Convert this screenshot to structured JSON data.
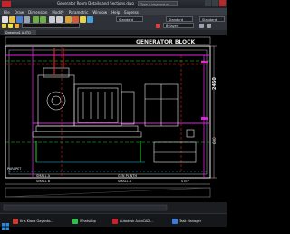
{
  "window": {
    "title": "Generator Room Details and Sections.dwg",
    "search_placeholder": "Type a keyword or phrase"
  },
  "menubar": {
    "items": [
      "File",
      "Draw",
      "Dimension",
      "Modify",
      "Parametric",
      "Window",
      "Help",
      "Express"
    ]
  },
  "ribbon": {
    "style_value": "Standard",
    "dim_style_value": "Standard",
    "right_value": "Standard"
  },
  "layer_panel": {
    "current_layer": "Bylayer"
  },
  "tabs": {
    "active": "Drawing1 AUTO"
  },
  "drawing": {
    "heading": "GENERATOR BLOCK",
    "label_left_a": "PARAPET",
    "label_left_b": "SMALL A",
    "label_left_c": "SMALL B",
    "label_mid_a": "GEN PLINTH",
    "label_mid_b": "SMALL A",
    "label_right_a": "STEP",
    "vert_dim": "2450",
    "right_dim": "600"
  },
  "taskbar": {
    "items": [
      {
        "label": "Kris Kiana Gayanto...",
        "color": "#d0392b"
      },
      {
        "label": "WhatsApp",
        "color": "#2fbf4c"
      },
      {
        "label": "Autodesk AutoCAD ...",
        "color": "#c8222a"
      },
      {
        "label": "Task Manager",
        "color": "#3d7bd8"
      }
    ]
  }
}
